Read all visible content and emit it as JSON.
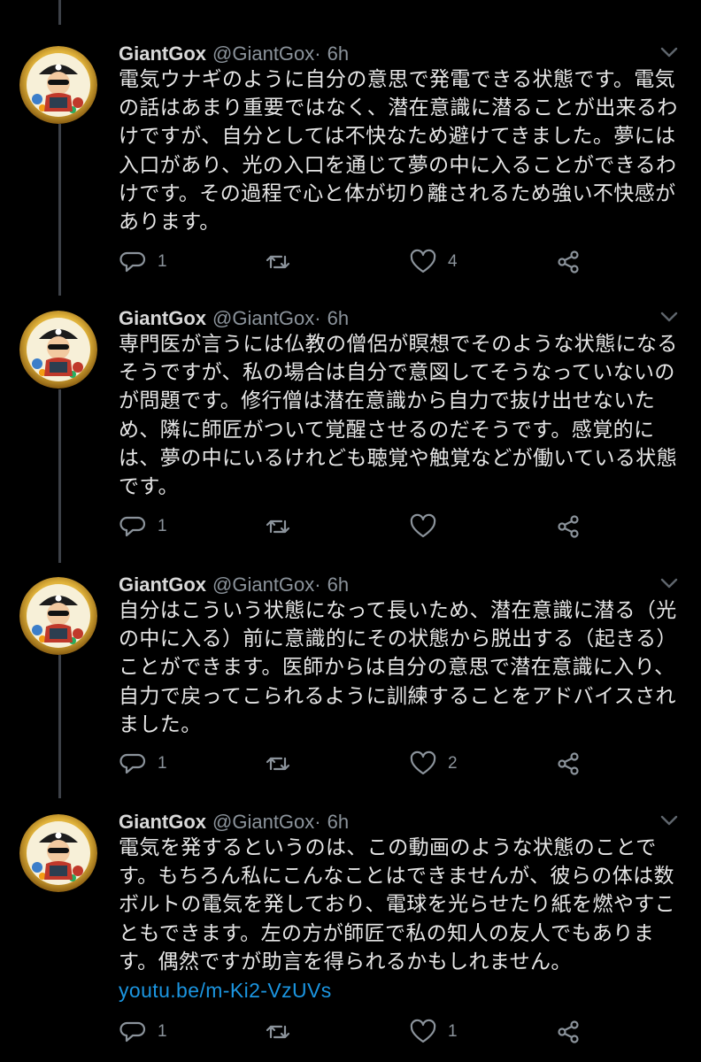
{
  "tweets": [
    {
      "name": "GiantGox",
      "handle": "@GiantGox",
      "dot": "·",
      "time": "6h",
      "lines": [
        "電気ウナギのように自分の意思で発電できる状態です。電気",
        "の話はあまり重要ではなく、潜在意識に潜ることが出来るわ",
        "けですが、自分としては不快なため避けてきました。夢には",
        "入口があり、光の入口を通じて夢の中に入ることができるわ",
        "けです。その過程で心と体が切り離されるため強い不快感が",
        "あります。"
      ],
      "link": "",
      "reply_count": "1",
      "retweet_count": "",
      "like_count": "4"
    },
    {
      "name": "GiantGox",
      "handle": "@GiantGox",
      "dot": "·",
      "time": "6h",
      "lines": [
        "専門医が言うには仏教の僧侶が瞑想でそのような状態になる",
        "そうですが、私の場合は自分で意図してそうなっていないの",
        "が問題です。修行僧は潜在意識から自力で抜け出せないた",
        "め、隣に師匠がついて覚醒させるのだそうです。感覚的に",
        "は、夢の中にいるけれども聴覚や触覚などが働いている状態",
        "です。"
      ],
      "link": "",
      "reply_count": "1",
      "retweet_count": "",
      "like_count": ""
    },
    {
      "name": "GiantGox",
      "handle": "@GiantGox",
      "dot": "·",
      "time": "6h",
      "lines": [
        "自分はこういう状態になって長いため、潜在意識に潜る（光",
        "の中に入る）前に意識的にその状態から脱出する（起きる）",
        "ことができます。医師からは自分の意思で潜在意識に入り、",
        "自力で戻ってこられるように訓練することをアドバイスされ",
        "ました。"
      ],
      "link": "",
      "reply_count": "1",
      "retweet_count": "",
      "like_count": "2"
    },
    {
      "name": "GiantGox",
      "handle": "@GiantGox",
      "dot": "·",
      "time": "6h",
      "lines": [
        "電気を発するというのは、この動画のような状態のことで",
        "す。もちろん私にこんなことはできませんが、彼らの体は数",
        "ボルトの電気を発しており、電球を光らせたり紙を燃やすこ",
        "ともできます。左の方が師匠で私の知人の友人でもありま",
        "す。偶然ですが助言を得られるかもしれません。"
      ],
      "link": "youtu.be/m-Ki2-VzUVs",
      "reply_count": "1",
      "retweet_count": "",
      "like_count": "1"
    }
  ],
  "icons": {
    "reply": "reply-icon",
    "retweet": "retweet-icon",
    "like": "heart-icon",
    "share": "share-icon",
    "caret": "chevron-down-icon"
  },
  "colors": {
    "background": "#000000",
    "text": "#d9d9d9",
    "secondary": "#8b939b",
    "link": "#1b95e0",
    "thread_line": "#3d4148"
  }
}
